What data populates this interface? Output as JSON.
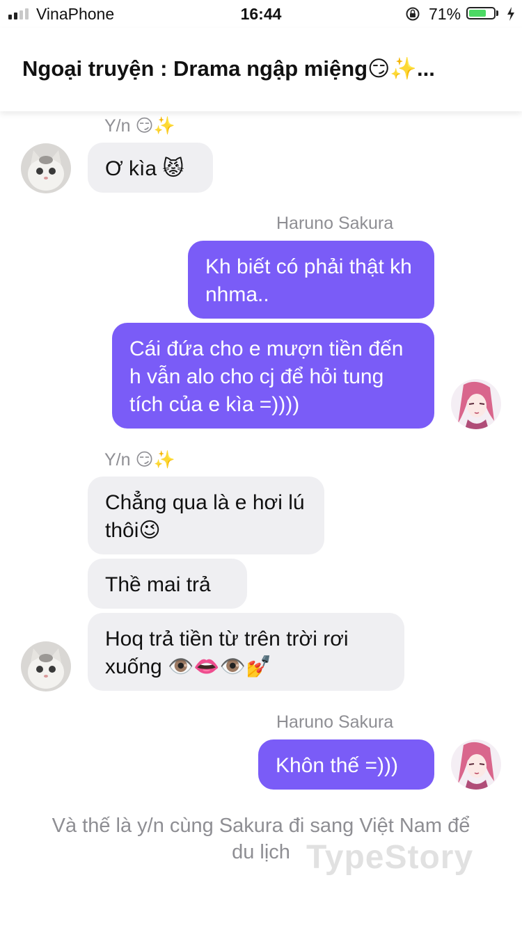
{
  "status_bar": {
    "carrier": "VinaPhone",
    "time": "16:44",
    "battery_percent": "71%",
    "battery_level": 0.71,
    "signal_bars_active": 2,
    "signal_bars_total": 4
  },
  "header": {
    "title": "Ngoại truyện : Drama ngập miệng😏✨..."
  },
  "colors": {
    "outgoing_bubble": "#7a5cf7",
    "incoming_bubble": "#efeff2",
    "battery_fill": "#4cd964"
  },
  "messages": {
    "g1": {
      "sender": "Y/n 😏✨",
      "m1": "Ơ kìa 😾"
    },
    "g2": {
      "sender": "Haruno Sakura",
      "m1": "Kh biết có phải thật kh nhma..",
      "m2": "Cái đứa cho e mượn tiền đến h vẫn alo cho cj để hỏi tung tích của e kìa =))))"
    },
    "g3": {
      "sender": "Y/n 😏✨",
      "m1": "Chẳng qua là e hơi lú thôi😉",
      "m2": "Thề mai trả",
      "m3": "Hoq trả tiền từ trên trời rơi xuống 👁️👄👁️💅"
    },
    "g4": {
      "sender": "Haruno Sakura",
      "m1": "Khôn thế =)))"
    }
  },
  "narration": "Và thế là y/n cùng Sakura đi sang Việt Nam để du lịch",
  "watermark": "TypeStory",
  "avatars": {
    "yn": "cat-avatar",
    "sakura": "anime-girl-avatar"
  }
}
